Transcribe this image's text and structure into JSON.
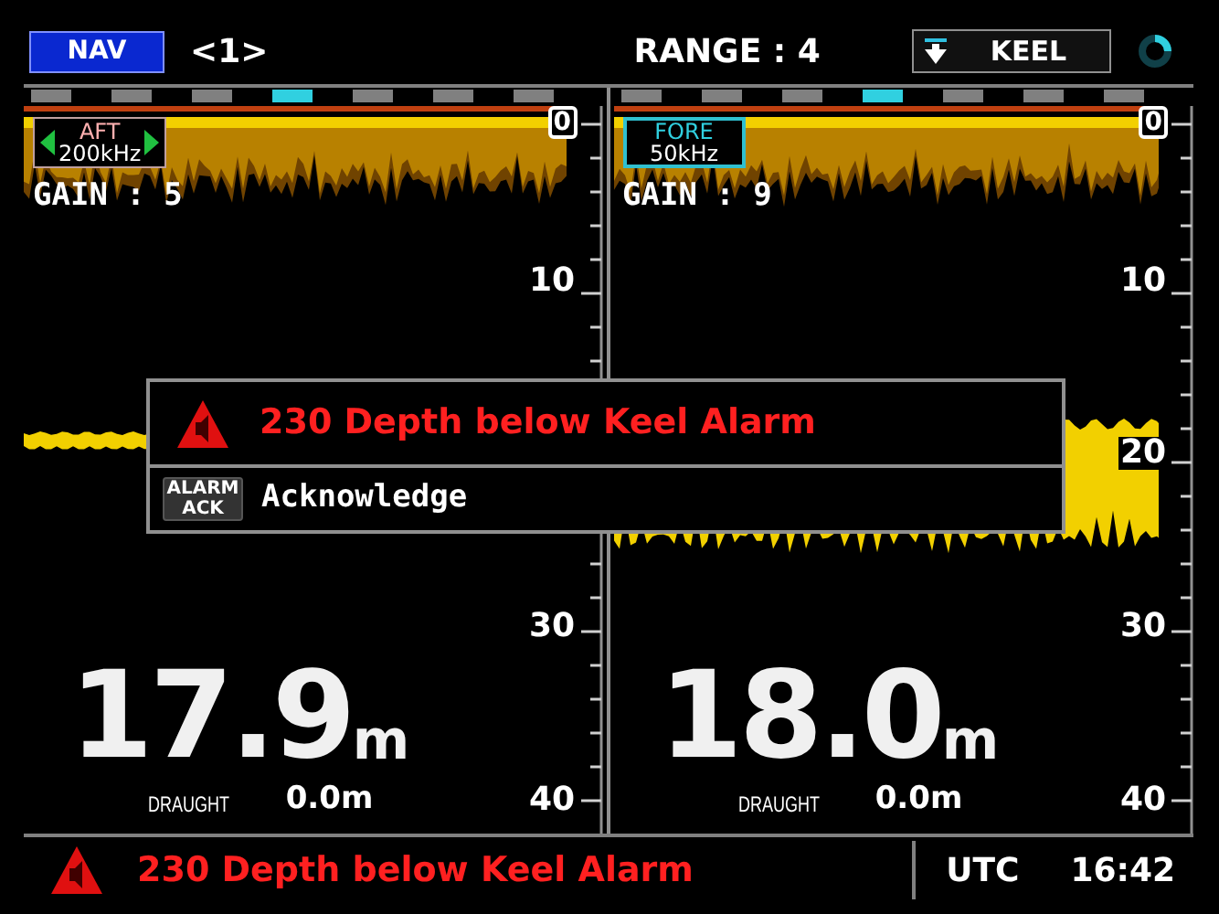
{
  "top_bar": {
    "mode_button": "NAV",
    "page": "<1>",
    "range": "RANGE : 4",
    "reference": "KEEL"
  },
  "panels": [
    {
      "transducer": {
        "name": "AFT",
        "frequency": "200kHz",
        "adjustable": true
      },
      "gain": "GAIN : 5",
      "scale_labels": [
        {
          "kind": "m0",
          "text": "0"
        },
        {
          "kind": "m10",
          "text": "10"
        },
        {
          "kind": "m30",
          "text": "30"
        },
        {
          "kind": "m40",
          "text": "40"
        }
      ],
      "depth": "17.9",
      "depth_unit": "m",
      "draught_label": "DRAUGHT",
      "draught": "0.0m"
    },
    {
      "transducer": {
        "name": "FORE",
        "frequency": "50kHz",
        "adjustable": false
      },
      "gain": "GAIN : 9",
      "scale_labels": [
        {
          "kind": "m0",
          "text": "0"
        },
        {
          "kind": "m10",
          "text": "10"
        },
        {
          "kind": "m20",
          "text": "20"
        },
        {
          "kind": "m30",
          "text": "30"
        },
        {
          "kind": "m40",
          "text": "40"
        }
      ],
      "depth": "18.0",
      "depth_unit": "m",
      "draught_label": "DRAUGHT",
      "draught": "0.0m"
    }
  ],
  "alarm_dialog": {
    "title": "230 Depth below Keel Alarm",
    "key_label": "ALARM ACK",
    "action": "Acknowledge"
  },
  "status_bar": {
    "alarm": "230 Depth below Keel Alarm",
    "timezone": "UTC",
    "time": "16:42"
  }
}
